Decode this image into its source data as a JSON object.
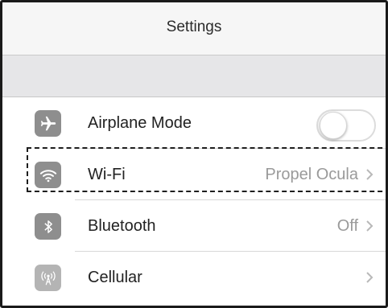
{
  "nav": {
    "title": "Settings"
  },
  "rows": [
    {
      "label": "Airplane Mode",
      "icon": "airplane-icon",
      "control": "toggle",
      "toggle_on": false
    },
    {
      "label": "Wi-Fi",
      "icon": "wifi-icon",
      "value": "Propel Ocula",
      "highlighted": true
    },
    {
      "label": "Bluetooth",
      "icon": "bluetooth-icon",
      "value": "Off"
    },
    {
      "label": "Cellular",
      "icon": "cellular-icon",
      "value": ""
    }
  ],
  "colors": {
    "icon_background": "#8e8e8e",
    "label_text": "#222222",
    "detail_text": "#9a9a9a",
    "group_background": "#e6e6e8"
  }
}
